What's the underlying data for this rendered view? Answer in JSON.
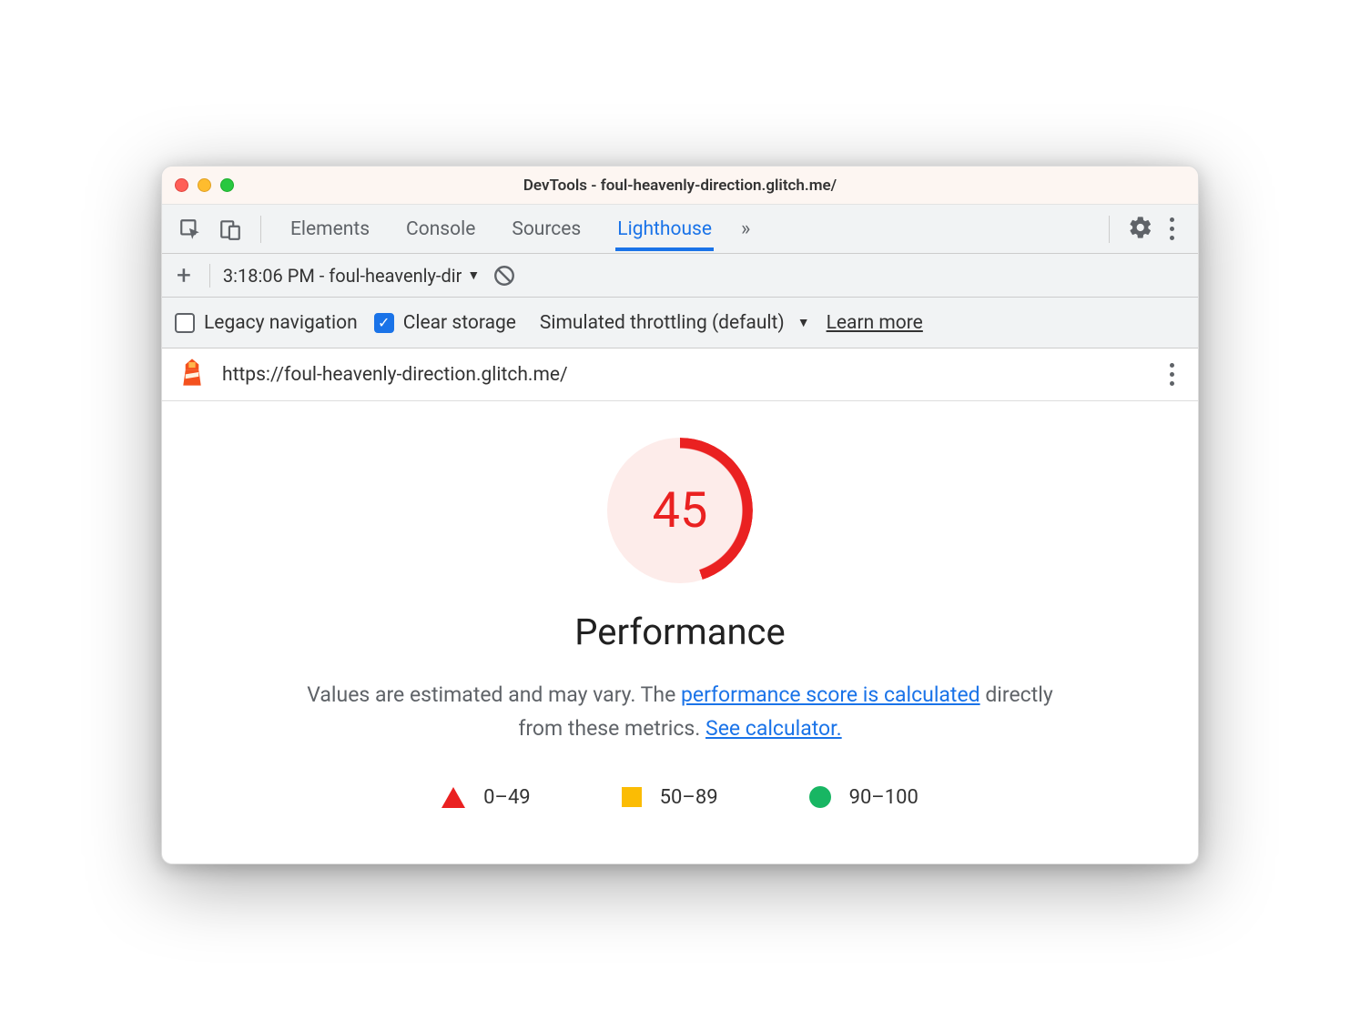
{
  "window": {
    "title": "DevTools - foul-heavenly-direction.glitch.me/"
  },
  "tabs": {
    "items": [
      "Elements",
      "Console",
      "Sources",
      "Lighthouse"
    ],
    "active_index": 3
  },
  "actionbar": {
    "run_label": "3:18:06 PM - foul-heavenly-dir"
  },
  "options": {
    "legacy_label": "Legacy navigation",
    "legacy_checked": false,
    "clear_label": "Clear storage",
    "clear_checked": true,
    "throttle_label": "Simulated throttling (default)",
    "learn_more": "Learn more"
  },
  "urlbar": {
    "url": "https://foul-heavenly-direction.glitch.me/"
  },
  "report": {
    "score": "45",
    "title": "Performance",
    "desc_prefix": "Values are estimated and may vary. The ",
    "link1": "performance score is calculated",
    "desc_mid": " directly from these metrics. ",
    "link2": "See calculator.",
    "legend": {
      "r0": "0–49",
      "r1": "50–89",
      "r2": "90–100"
    }
  }
}
